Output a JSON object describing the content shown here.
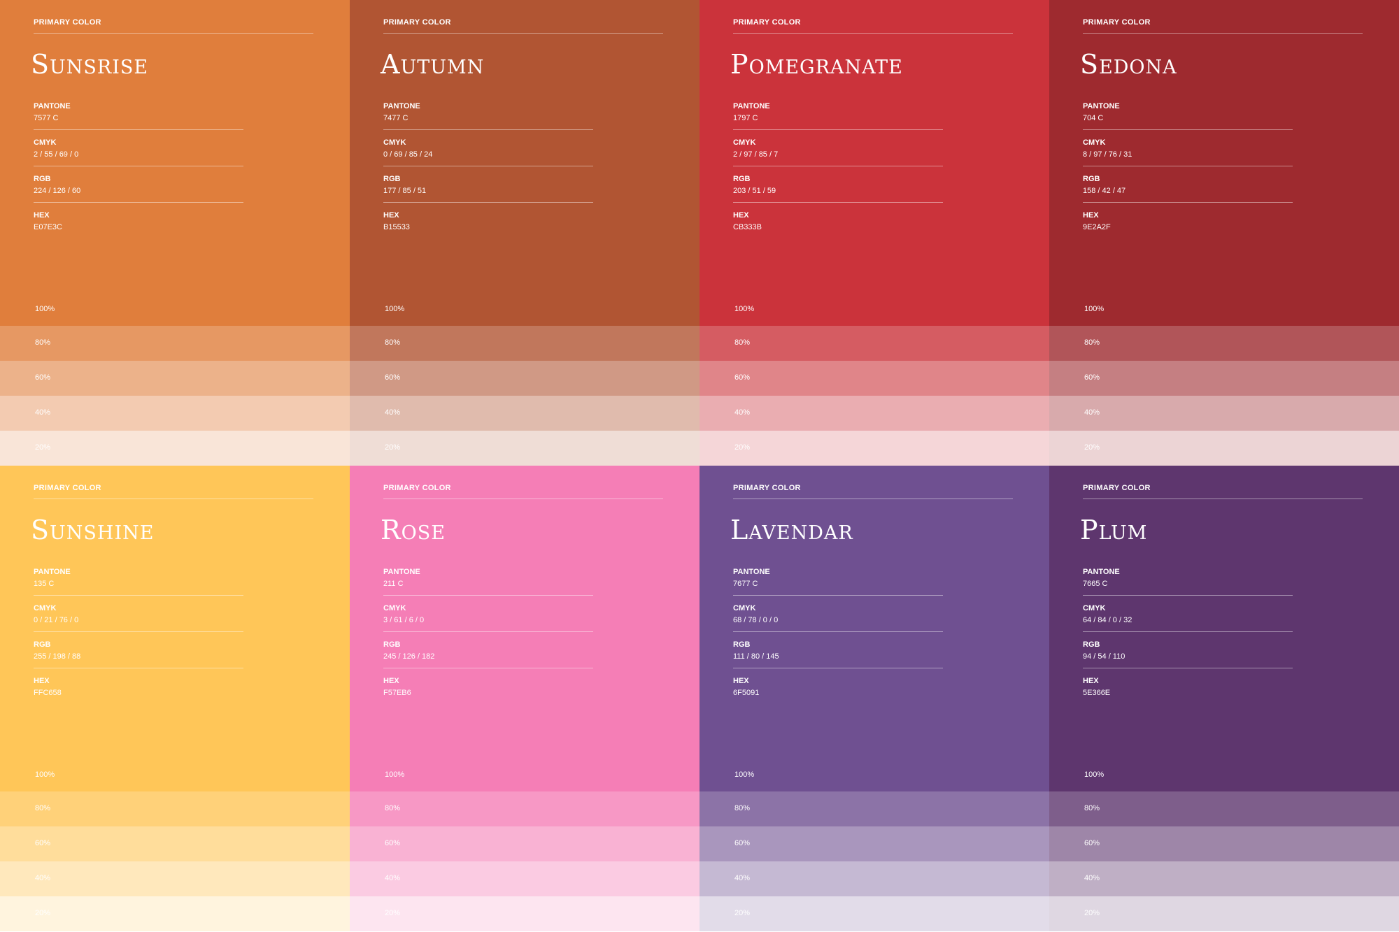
{
  "primary_label": "PRIMARY COLOR",
  "spec_labels": {
    "pantone": "PANTONE",
    "cmyk": "CMYK",
    "rgb": "RGB",
    "hex": "HEX"
  },
  "tints": [
    "100%",
    "80%",
    "60%",
    "40%",
    "20%"
  ],
  "colors": [
    {
      "name": "Sunsrise",
      "pantone": "7577 C",
      "cmyk": "2 / 55 / 69 / 0",
      "rgb": "224 / 126 / 60",
      "hex": "E07E3C",
      "swatch": "#E07E3C"
    },
    {
      "name": "Autumn",
      "pantone": "7477 C",
      "cmyk": "0 / 69 / 85 / 24",
      "rgb": "177 / 85 / 51",
      "hex": "B15533",
      "swatch": "#B15533"
    },
    {
      "name": "Pomegranate",
      "pantone": "1797 C",
      "cmyk": "2 / 97 / 85 / 7",
      "rgb": "203 / 51 / 59",
      "hex": "CB333B",
      "swatch": "#CB333B"
    },
    {
      "name": "Sedona",
      "pantone": "704 C",
      "cmyk": "8 / 97 / 76 / 31",
      "rgb": "158 / 42 / 47",
      "hex": "9E2A2F",
      "swatch": "#9E2A2F"
    },
    {
      "name": "Sunshine",
      "pantone": "135 C",
      "cmyk": "0 / 21 / 76 / 0",
      "rgb": "255 / 198 / 88",
      "hex": "FFC658",
      "swatch": "#FFC658"
    },
    {
      "name": "Rose",
      "pantone": "211 C",
      "cmyk": "3 / 61 / 6 / 0",
      "rgb": "245 / 126 / 182",
      "hex": "F57EB6",
      "swatch": "#F57EB6"
    },
    {
      "name": "Lavendar",
      "pantone": "7677 C",
      "cmyk": "68 / 78 / 0 / 0",
      "rgb": "111 / 80 / 145",
      "hex": "6F5091",
      "swatch": "#6F5091"
    },
    {
      "name": "Plum",
      "pantone": "7665 C",
      "cmyk": "64 / 84 / 0 / 32",
      "rgb": "94 / 54 / 110",
      "hex": "5E366E",
      "swatch": "#5E366E"
    }
  ]
}
